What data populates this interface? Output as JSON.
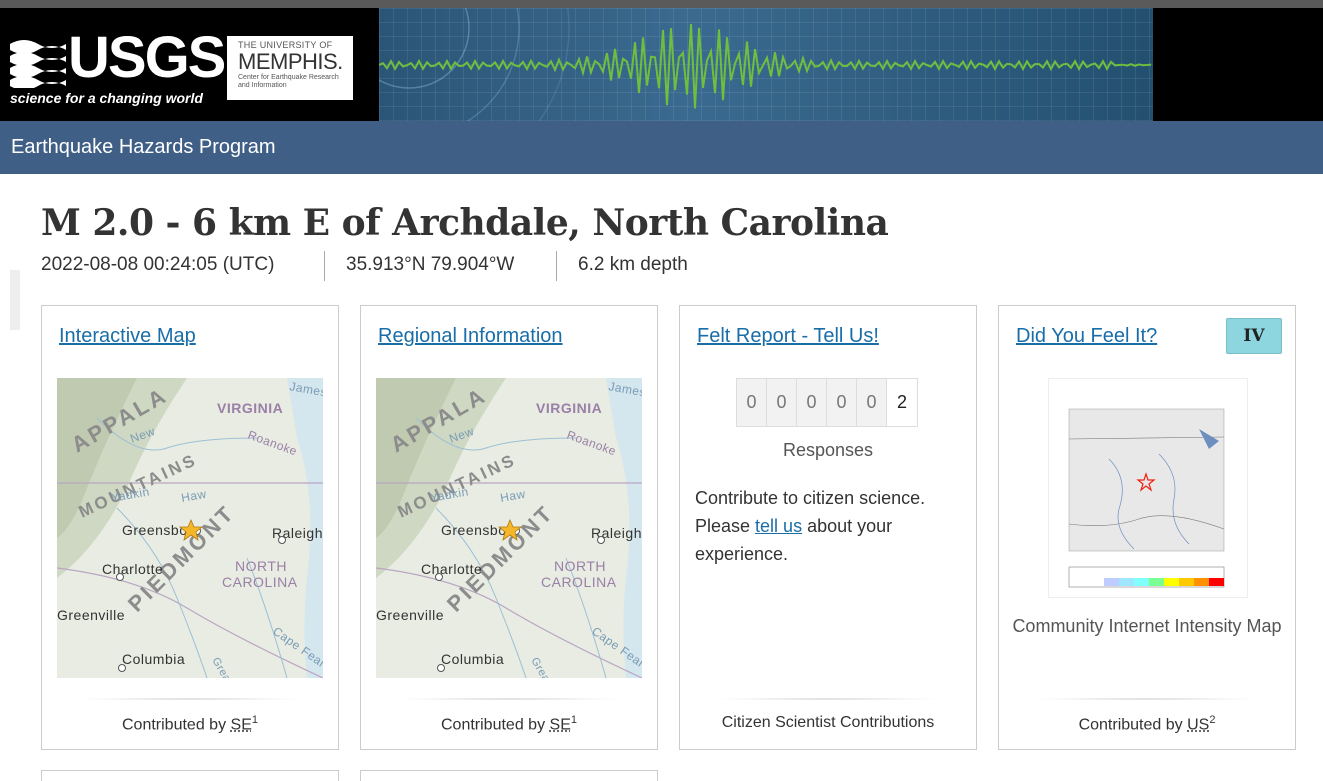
{
  "header": {
    "usgs_logo_text": "USGS",
    "usgs_tagline": "science for a changing world",
    "memphis_line1": "THE UNIVERSITY OF",
    "memphis_line2": "MEMPHIS.",
    "memphis_line3": "Center for Earthquake Research and Information"
  },
  "nav": {
    "title": "Earthquake Hazards Program"
  },
  "event": {
    "title": "M 2.0 - 6 km E of Archdale, North Carolina",
    "time": "2022-08-08 00:24:05 (UTC)",
    "location": "35.913°N 79.904°W",
    "depth": "6.2 km depth"
  },
  "cards": {
    "interactive_map": {
      "link": "Interactive Map",
      "contrib_prefix": "Contributed by ",
      "contrib_source": "SE",
      "contrib_sup": "1"
    },
    "regional": {
      "link": "Regional Information",
      "contrib_prefix": "Contributed by ",
      "contrib_source": "SE",
      "contrib_sup": "1"
    },
    "felt": {
      "link": "Felt Report - Tell Us!",
      "digits": [
        "0",
        "0",
        "0",
        "0",
        "0",
        "2"
      ],
      "responses_label": "Responses",
      "text_before": "Contribute to citizen science. Please ",
      "text_link": "tell us",
      "text_after": " about your experience.",
      "contrib": "Citizen Scientist Contributions"
    },
    "dyfi": {
      "link": "Did You Feel It?",
      "badge": "IV",
      "caption": "Community Internet Intensity Map",
      "contrib_prefix": "Contributed by ",
      "contrib_source": "US",
      "contrib_sup": "2"
    }
  },
  "map_labels": [
    "VIRGINIA",
    "Roanoke",
    "APPALA",
    "MOUNTAINS",
    "New",
    "Yadkin",
    "Haw",
    "Greensboro",
    "Raleigh",
    "PIEDMONT",
    "NORTH",
    "CAROLINA",
    "Charlotte",
    "Greenville",
    "Columbia",
    "Cape Fear",
    "James",
    "Great Pee Dee"
  ],
  "colors": {
    "nav_bg": "#3f5f86",
    "link": "#1a6ea8",
    "badge_iv": "#8dd6e0"
  }
}
